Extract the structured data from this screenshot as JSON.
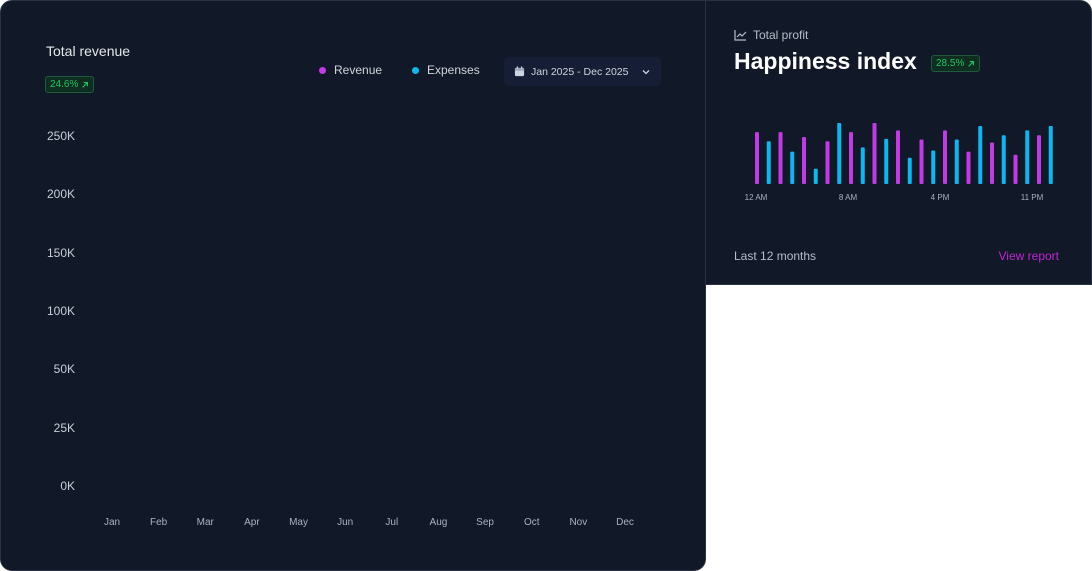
{
  "colors": {
    "revenue": "#c13ae5",
    "expenses": "#0cb8f0",
    "positive": "#22c55e",
    "accent": "#c026d3"
  },
  "revenue_card": {
    "title": "Total revenue",
    "change": "24.6%",
    "legend": {
      "revenue": "Revenue",
      "expenses": "Expenses"
    },
    "date_range": "Jan 2025 - Dec 2025",
    "icons": {
      "calendar": "calendar-icon",
      "chevron": "chevron-down-icon",
      "trend": "arrow-up-right-icon"
    }
  },
  "profit_card": {
    "label": "Total profit",
    "title": "Happiness index",
    "change": "28.5%",
    "footer": "Last 12 months",
    "link": "View report",
    "icons": {
      "header": "line-chart-icon",
      "trend": "arrow-up-right-icon"
    }
  },
  "chart_data": [
    {
      "type": "bar",
      "title": "Total revenue",
      "categories": [
        "Jan",
        "Feb",
        "Mar",
        "Apr",
        "May",
        "Jun",
        "Jul",
        "Aug",
        "Sep",
        "Oct",
        "Nov",
        "Dec"
      ],
      "y_ticks": [
        "250K",
        "200K",
        "150K",
        "100K",
        "50K",
        "25K",
        "0K"
      ],
      "series": [
        {
          "name": "Revenue",
          "values": []
        },
        {
          "name": "Expenses",
          "values": []
        }
      ],
      "grid": false,
      "legend_position": "top-right"
    },
    {
      "type": "bar",
      "title": "Happiness index",
      "x_tick_labels": [
        "12 AM",
        "8 AM",
        "4 PM",
        "11 PM"
      ],
      "bars": [
        {
          "series": "revenue",
          "value": 85
        },
        {
          "series": "expenses",
          "value": 70
        },
        {
          "series": "revenue",
          "value": 85
        },
        {
          "series": "expenses",
          "value": 53
        },
        {
          "series": "revenue",
          "value": 77
        },
        {
          "series": "expenses",
          "value": 25
        },
        {
          "series": "revenue",
          "value": 70
        },
        {
          "series": "expenses",
          "value": 100
        },
        {
          "series": "revenue",
          "value": 85
        },
        {
          "series": "expenses",
          "value": 60
        },
        {
          "series": "revenue",
          "value": 100
        },
        {
          "series": "expenses",
          "value": 74
        },
        {
          "series": "revenue",
          "value": 88
        },
        {
          "series": "expenses",
          "value": 43
        },
        {
          "series": "revenue",
          "value": 73
        },
        {
          "series": "expenses",
          "value": 55
        },
        {
          "series": "revenue",
          "value": 88
        },
        {
          "series": "expenses",
          "value": 73
        },
        {
          "series": "revenue",
          "value": 53
        },
        {
          "series": "expenses",
          "value": 95
        },
        {
          "series": "revenue",
          "value": 68
        },
        {
          "series": "expenses",
          "value": 80
        },
        {
          "series": "revenue",
          "value": 48
        },
        {
          "series": "expenses",
          "value": 88
        },
        {
          "series": "revenue",
          "value": 80
        },
        {
          "series": "expenses",
          "value": 95
        }
      ],
      "legend_position": "none"
    }
  ]
}
